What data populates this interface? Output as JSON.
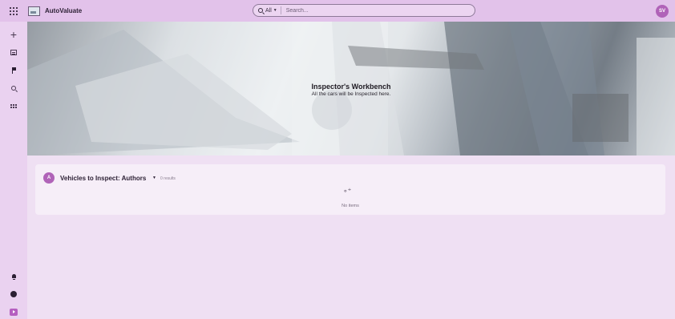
{
  "header": {
    "app_title": "AutoValuate",
    "search_scope": "All",
    "search_placeholder": "Search...",
    "user_initials": "SV"
  },
  "rail": {
    "icons": [
      "plus-icon",
      "list-icon",
      "flag-icon",
      "search-icon",
      "grid-icon"
    ],
    "bottom_icons": [
      "bell-icon",
      "help-icon",
      "expand-icon"
    ]
  },
  "hero": {
    "title": "Inspector's Workbench",
    "subtitle": "All the cars will be Inspected here."
  },
  "section": {
    "avatar_letter": "A",
    "title": "Vehicles to Inspect: Authors",
    "results": "0 results",
    "empty_text": "No items"
  },
  "colors": {
    "topbar": "#e2c2ea",
    "accent": "#b063b8",
    "background": "#efe0f3"
  }
}
